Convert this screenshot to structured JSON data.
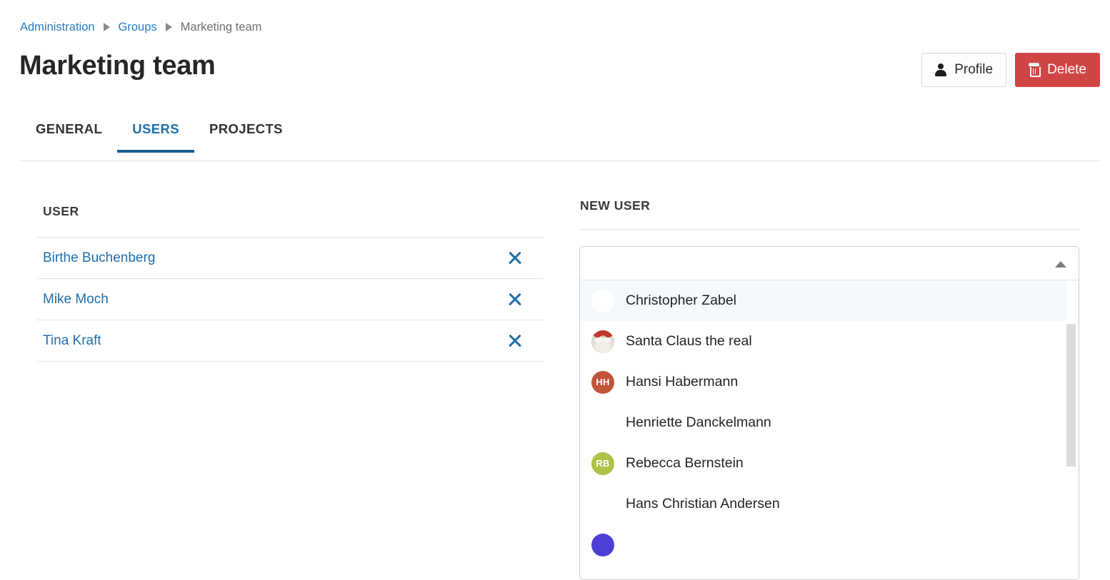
{
  "breadcrumb": {
    "items": [
      {
        "label": "Administration",
        "type": "link"
      },
      {
        "label": "Groups",
        "type": "link"
      },
      {
        "label": "Marketing team",
        "type": "current"
      }
    ]
  },
  "page": {
    "title": "Marketing team"
  },
  "header_actions": {
    "profile_label": "Profile",
    "delete_label": "Delete",
    "profile_icon": "person-icon",
    "delete_icon": "trash-icon",
    "delete_color": "#cf4545"
  },
  "tabs": [
    {
      "label": "GENERAL",
      "active": false
    },
    {
      "label": "USERS",
      "active": true
    },
    {
      "label": "PROJECTS",
      "active": false
    }
  ],
  "accent_color": "#1f6eab",
  "users_panel": {
    "heading": "USER",
    "remove_icon": "close-x-icon",
    "rows": [
      {
        "name": "Birthe Buchenberg"
      },
      {
        "name": "Mike Moch"
      },
      {
        "name": "Tina Kraft"
      }
    ]
  },
  "new_user_panel": {
    "heading": "NEW USER",
    "combobox": {
      "value": "",
      "placeholder": "",
      "expanded": true,
      "caret_icon": "chevron-up-icon"
    },
    "options": [
      {
        "name": "Christopher Zabel",
        "avatar_type": "blank",
        "initials": "",
        "avatar_color": "#ffffff",
        "highlighted": true
      },
      {
        "name": "Santa Claus the real",
        "avatar_type": "photo",
        "initials": "",
        "avatar_color": "#c0392b",
        "highlighted": false
      },
      {
        "name": "Hansi Habermann",
        "avatar_type": "initials",
        "initials": "HH",
        "avatar_color": "#c1553a",
        "highlighted": false
      },
      {
        "name": "Henriette Danckelmann",
        "avatar_type": "none",
        "initials": "",
        "avatar_color": "",
        "highlighted": false
      },
      {
        "name": "Rebecca Bernstein",
        "avatar_type": "initials",
        "initials": "RB",
        "avatar_color": "#aec245",
        "highlighted": false
      },
      {
        "name": "Hans Christian Andersen",
        "avatar_type": "none",
        "initials": "",
        "avatar_color": "",
        "highlighted": false
      }
    ],
    "partial_option": {
      "name": "",
      "avatar_type": "initials",
      "initials": "",
      "avatar_color": "#4b3fd6"
    }
  }
}
